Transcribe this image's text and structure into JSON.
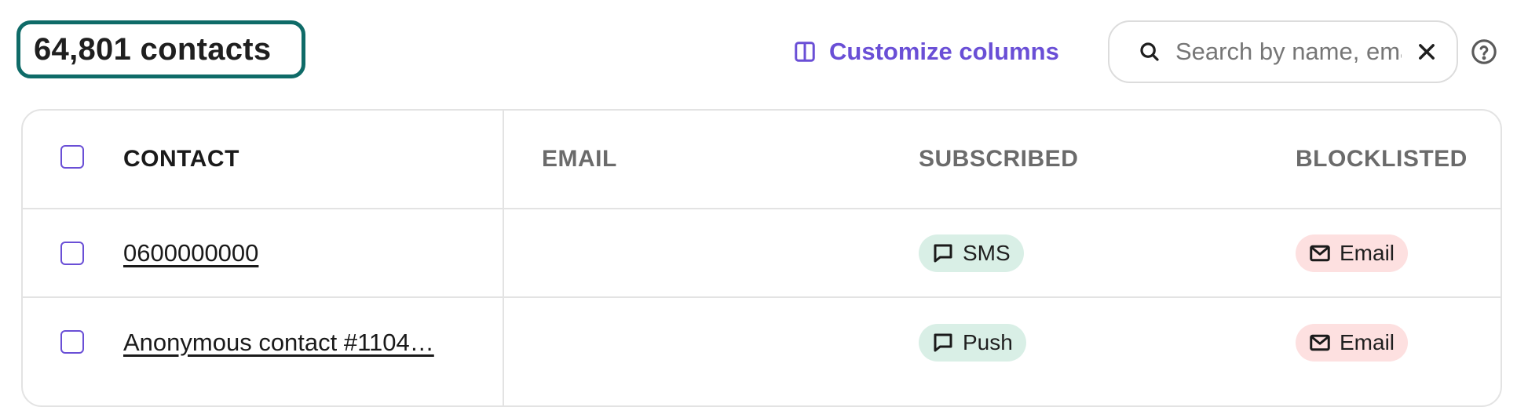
{
  "header": {
    "contact_count": "64,801 contacts",
    "customize_label": "Customize columns",
    "search_placeholder": "Search by name, email or phone"
  },
  "colors": {
    "accent": "#6a4fd6",
    "count_border": "#0f6b68",
    "subscribed_bg": "#d9efe6",
    "blocklisted_bg": "#fde0e0"
  },
  "table": {
    "columns": [
      "CONTACT",
      "EMAIL",
      "SUBSCRIBED",
      "BLOCKLISTED"
    ],
    "rows": [
      {
        "contact": "0600000000",
        "email": "",
        "subscribed": "SMS",
        "subscribed_icon": "chat-icon",
        "blocklisted": "Email",
        "blocklisted_icon": "mail-icon"
      },
      {
        "contact": "Anonymous contact #1104…",
        "email": "",
        "subscribed": "Push",
        "subscribed_icon": "chat-icon",
        "blocklisted": "Email",
        "blocklisted_icon": "mail-icon"
      }
    ]
  }
}
